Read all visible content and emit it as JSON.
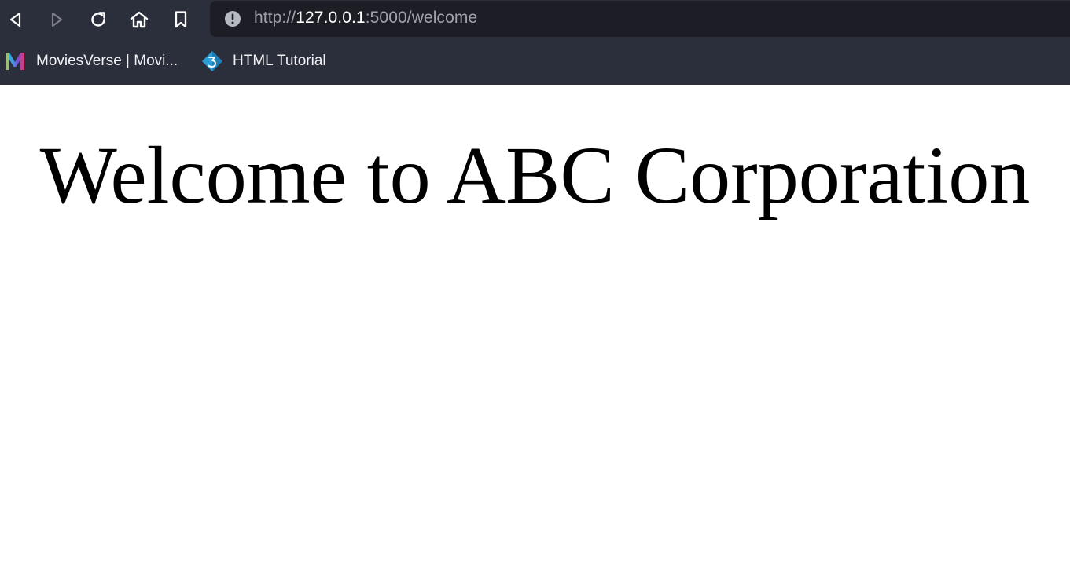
{
  "toolbar": {
    "back_icon": "back-arrow-icon",
    "forward_icon": "forward-arrow-icon",
    "reload_icon": "reload-icon",
    "home_icon": "home-icon",
    "bookmark_icon": "bookmark-icon"
  },
  "address_bar": {
    "security_icon": "not-secure-info-icon",
    "url_scheme": "http://",
    "url_host": "127.0.0.1",
    "url_rest": ":5000/welcome"
  },
  "bookmarks": [
    {
      "label": "MoviesVerse | Movi...",
      "icon": "moviesverse-logo-icon"
    },
    {
      "label": "HTML Tutorial",
      "icon": "w3schools-logo-icon"
    }
  ],
  "page": {
    "heading": "Welcome to ABC Corporation"
  },
  "colors": {
    "chrome_bg": "#2b2e3b",
    "address_bg": "#1c1d25",
    "url_dim": "#a0a3ad",
    "url_bright": "#ffffff",
    "page_bg": "#ffffff",
    "heading": "#000000"
  }
}
